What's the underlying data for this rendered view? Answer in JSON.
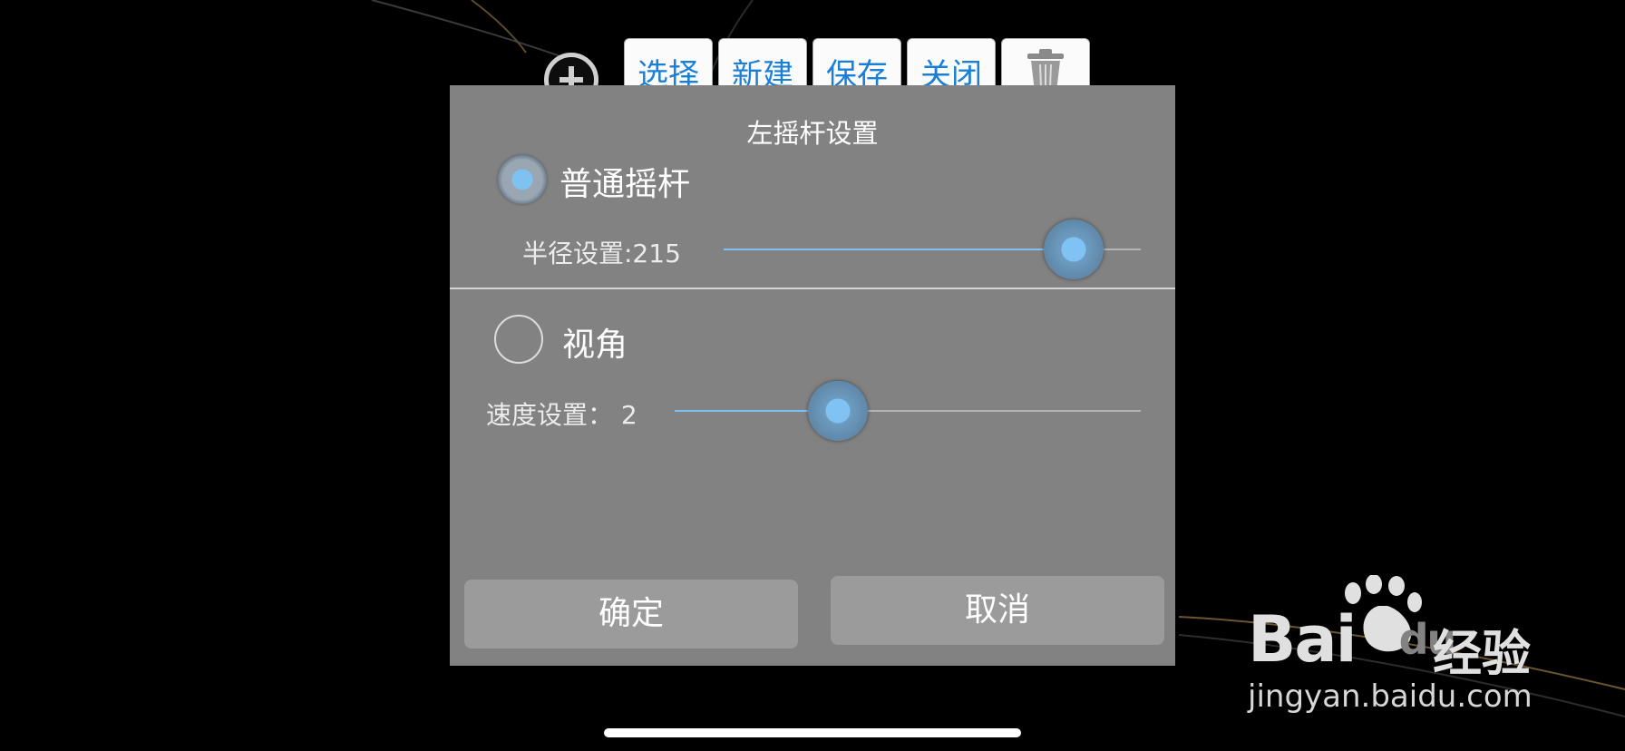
{
  "toolbar": {
    "add_icon": "plus-circle-icon",
    "buttons": [
      {
        "label": "选择"
      },
      {
        "label": "新建"
      },
      {
        "label": "保存"
      },
      {
        "label": "关闭"
      }
    ],
    "trash_icon": "trash-icon"
  },
  "dialog": {
    "title": "左摇杆设置",
    "options": [
      {
        "label": "普通摇杆",
        "checked": true,
        "setting_label": "半径设置:215",
        "slider_fraction": 0.84
      },
      {
        "label": "视角",
        "checked": false,
        "setting_label": "速度设置：  2",
        "slider_fraction": 0.35
      }
    ],
    "confirm_label": "确定",
    "cancel_label": "取消"
  },
  "watermark": {
    "brand": "Bai",
    "brand_du": "du",
    "brand_cn": "经验",
    "url": "jingyan.baidu.com"
  },
  "colors": {
    "accent": "#7fc2f2",
    "dialog_bg": "#828282",
    "button_text": "#1a7fd6"
  }
}
